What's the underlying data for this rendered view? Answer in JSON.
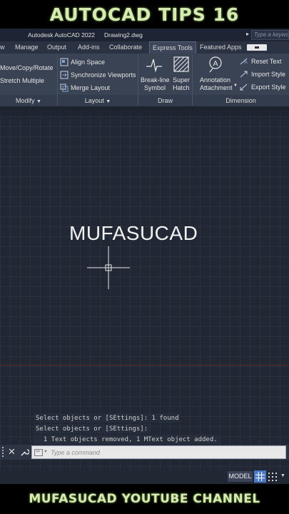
{
  "banner": {
    "top": "AUTOCAD TIPS 16",
    "bottom": "MUFASUCAD YOUTUBE CHANNEL"
  },
  "titlebar": {
    "app_name": "Autodesk AutoCAD 2022",
    "document": "Drawing2.dwg",
    "search_placeholder": "Type a keyword"
  },
  "tabs": [
    {
      "label": "w"
    },
    {
      "label": "Manage"
    },
    {
      "label": "Output"
    },
    {
      "label": "Add-ins"
    },
    {
      "label": "Collaborate"
    },
    {
      "label": "Express Tools",
      "active": true
    },
    {
      "label": "Featured Apps"
    }
  ],
  "ribbon": {
    "modify": {
      "items": [
        "Move/Copy/Rotate",
        "Stretch Multiple"
      ],
      "label": "Modify"
    },
    "layout": {
      "items": [
        "Align Space",
        "Synchronize Viewports",
        "Merge Layout"
      ],
      "label": "Layout"
    },
    "draw": {
      "breakline_1": "Break-line",
      "breakline_2": "Symbol",
      "hatch_1": "Super",
      "hatch_2": "Hatch",
      "label": "Draw"
    },
    "dimension": {
      "annotation_1": "Annotation",
      "annotation_2": "Attachment",
      "items": [
        "Reset Text",
        "Import Style",
        "Export Style"
      ],
      "label": "Dimension"
    }
  },
  "canvas": {
    "mtext": "MUFASUCAD"
  },
  "command": {
    "history": [
      "Select objects or [SEttings]: 1 found",
      "Select objects or [SEttings]:",
      "  1 Text objects removed, 1 MText object added."
    ],
    "placeholder": "Type a command"
  },
  "status": {
    "model": "MODEL"
  }
}
